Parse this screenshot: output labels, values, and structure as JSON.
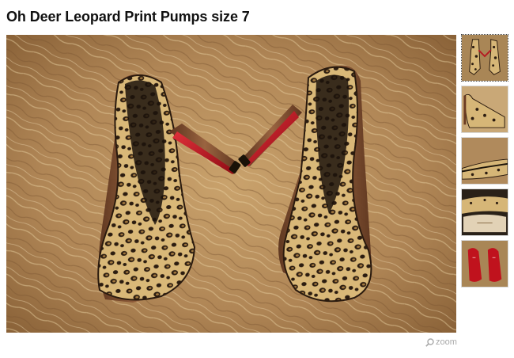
{
  "product": {
    "title": "Oh Deer Leopard Print Pumps size 7"
  },
  "gallery": {
    "main_image": "leopard-print-pumps-on-fur-rug",
    "thumbnails": [
      {
        "image": "pumps-top-view",
        "selected": true
      },
      {
        "image": "pump-side-view",
        "selected": false
      },
      {
        "image": "pump-heel-closeup",
        "selected": false
      },
      {
        "image": "pump-insole-label",
        "selected": false
      },
      {
        "image": "red-soles",
        "selected": false
      }
    ],
    "zoom_label": "zoom",
    "zoom_icon": "magnifier-icon"
  },
  "colors": {
    "fur": "#b7905d",
    "leopard_base": "#d9b878",
    "leopard_spot": "#2b1c10",
    "sole_red": "#c0121d",
    "heel_wood": "#7a4a2c"
  }
}
